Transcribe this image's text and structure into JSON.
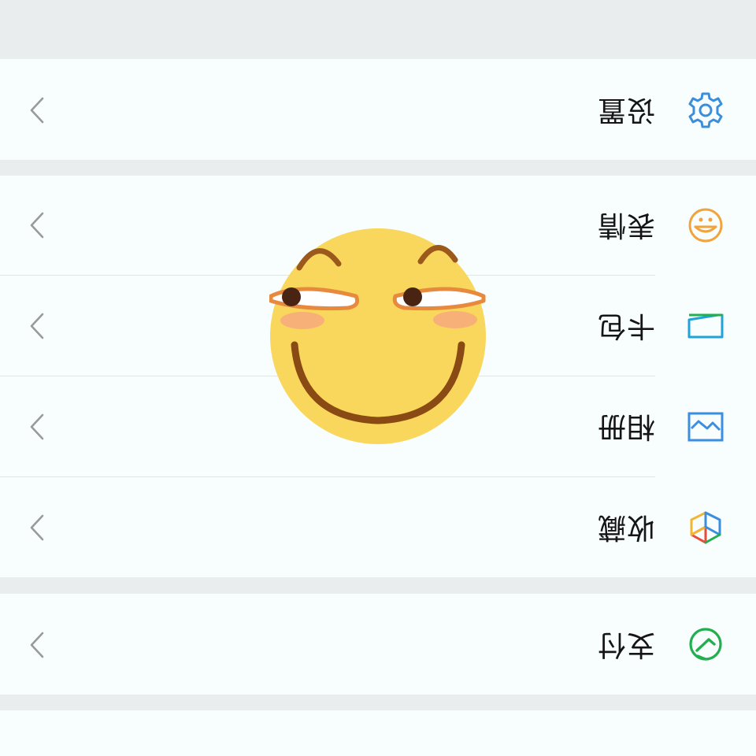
{
  "menu": {
    "pay": {
      "label": "支付",
      "icon": "pay-icon",
      "color": "#22b04e"
    },
    "favorites": {
      "label": "收藏",
      "icon": "favorites-cube-icon"
    },
    "album": {
      "label": "相册",
      "icon": "album-icon",
      "color": "#3b8ee0"
    },
    "wallet": {
      "label": "卡包",
      "icon": "card-wallet-icon",
      "color": "#1fa3d8"
    },
    "stickers": {
      "label": "表情",
      "icon": "emoji-icon",
      "color": "#f0a43c"
    },
    "settings": {
      "label": "设置",
      "icon": "gear-icon",
      "color": "#3a8edb"
    }
  },
  "overlay": {
    "sticker": "smirking-emoji-sticker"
  },
  "colors": {
    "background": "#eaeded",
    "row_background": "#f8fdfd",
    "chevron": "#9a9a9a"
  }
}
